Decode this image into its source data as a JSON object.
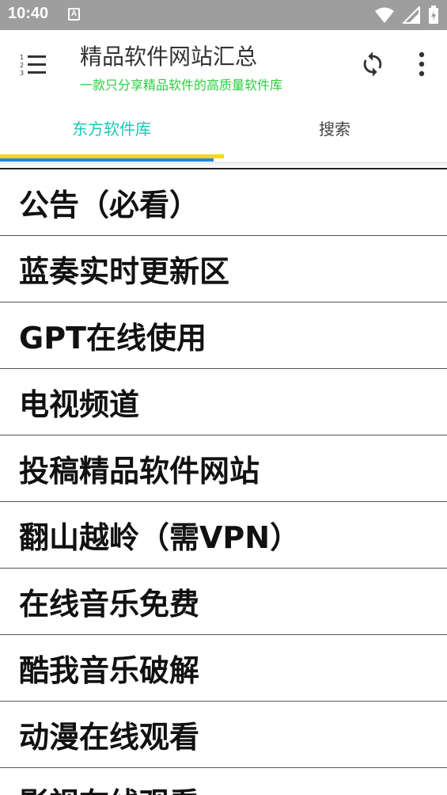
{
  "status_bar": {
    "time": "10:40",
    "notification_icon": "A"
  },
  "app_bar": {
    "title": "精品软件网站汇总",
    "subtitle": "一款只分享精品软件的高质量软件库",
    "menu_icon": "numbered-list-icon",
    "refresh_icon": "refresh-icon",
    "more_icon": "more-vert-icon"
  },
  "tabs": [
    {
      "label": "东方软件库",
      "selected": true
    },
    {
      "label": "搜索",
      "selected": false
    }
  ],
  "colors": {
    "status_bar": "#9e9e9e",
    "subtitle": "#2ecc40",
    "active_tab": "#1cc7b4",
    "indicator_yellow": "#f5d80c",
    "indicator_blue": "#1e88e5"
  },
  "list": {
    "items": [
      "公告（必看）",
      "蓝奏实时更新区",
      "GPT在线使用",
      "电视频道",
      "投稿精品软件网站",
      "翻山越岭（需VPN）",
      "在线音乐免费",
      "酷我音乐破解",
      "动漫在线观看",
      "影视在线观看"
    ]
  }
}
